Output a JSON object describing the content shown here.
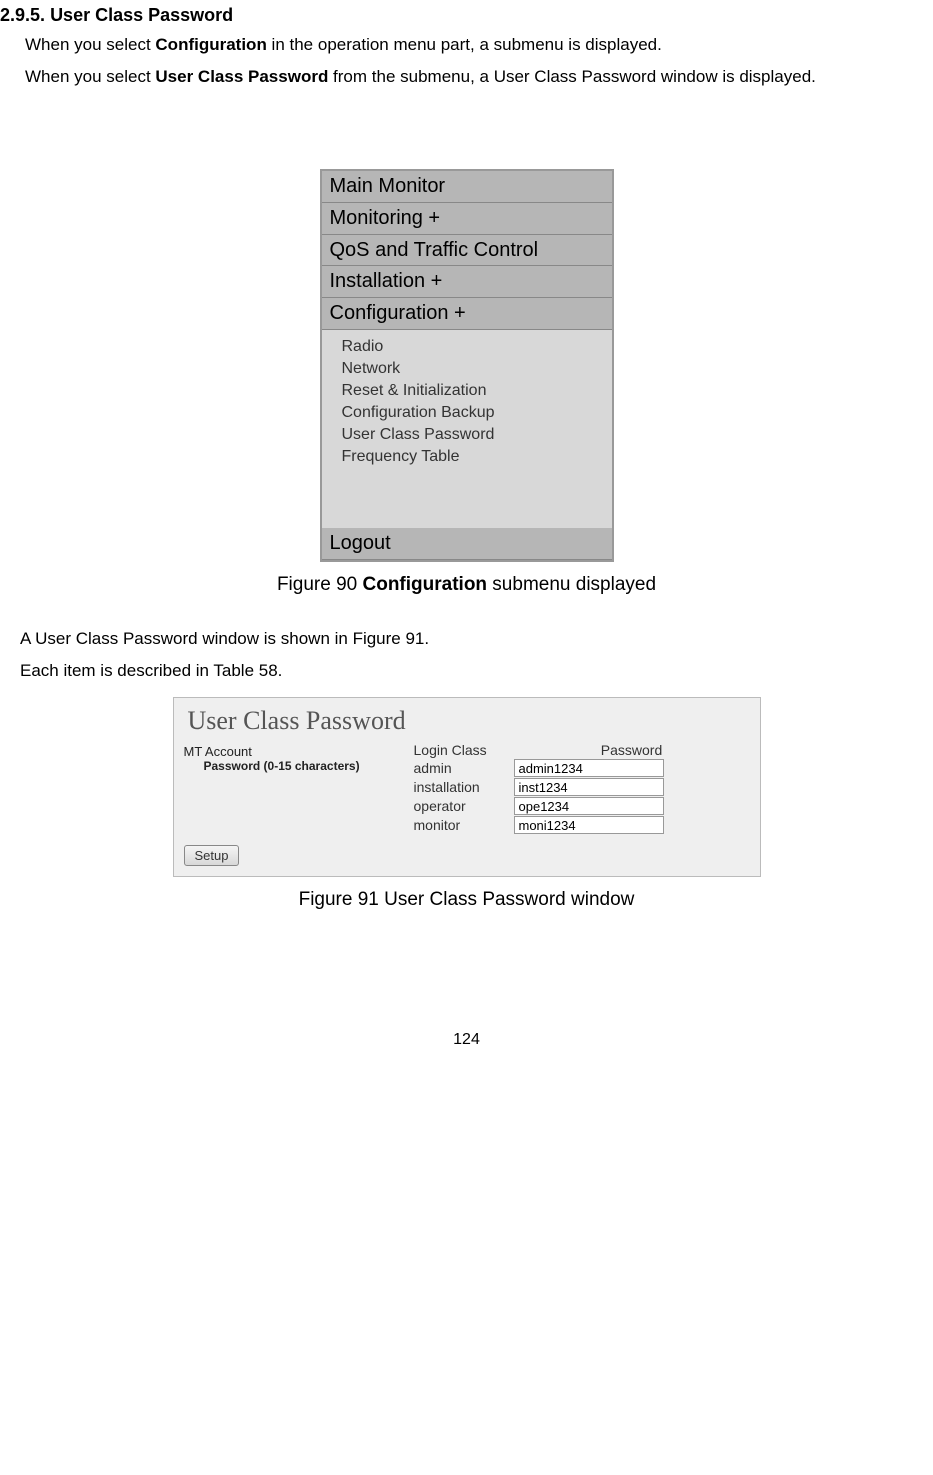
{
  "section": {
    "number": "2.9.5.",
    "title": "User Class Password"
  },
  "paragraphs": {
    "p1_a": "When you select ",
    "p1_b": "Configuration",
    "p1_c": " in the operation menu part, a submenu is displayed.",
    "p2_a": "When you select ",
    "p2_b": "User Class Password",
    "p2_c": " from the submenu, a User Class Password window is displayed.",
    "p3": "A User Class Password window is shown in Figure 91.",
    "p4": "Each item is described in Table 58."
  },
  "menu": {
    "items": [
      "Main Monitor",
      "Monitoring +",
      "QoS and Traffic Control",
      "Installation +",
      "Configuration +"
    ],
    "submenu": [
      "Radio",
      "Network",
      "Reset & Initialization",
      "Configuration Backup",
      "User Class Password",
      "Frequency Table"
    ],
    "logout": "Logout"
  },
  "figure90": {
    "prefix": "Figure 90 ",
    "bold": "Configuration",
    "suffix": " submenu displayed"
  },
  "ucp": {
    "title": "User Class Password",
    "left_line1": "MT Account",
    "left_line2": "Password (0-15 characters)",
    "header_loginclass": "Login Class",
    "header_password": "Password",
    "rows": [
      {
        "label": "admin",
        "value": "admin1234"
      },
      {
        "label": "installation",
        "value": "inst1234"
      },
      {
        "label": "operator",
        "value": "ope1234"
      },
      {
        "label": "monitor",
        "value": "moni1234"
      }
    ],
    "setup": "Setup"
  },
  "figure91": "Figure 91 User Class Password window",
  "page_number": "124"
}
